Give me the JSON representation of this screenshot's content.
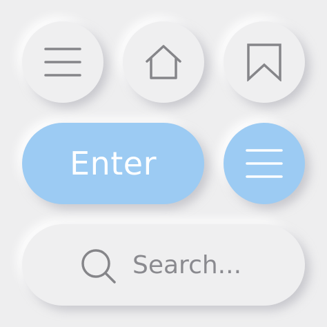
{
  "buttons": {
    "menu": {
      "icon": "hamburger-menu-icon"
    },
    "home": {
      "icon": "home-icon"
    },
    "bookmark": {
      "icon": "bookmark-icon"
    },
    "enter": {
      "label": "Enter"
    },
    "menu_accent": {
      "icon": "hamburger-menu-icon"
    }
  },
  "search": {
    "placeholder": "Search...",
    "icon": "search-icon"
  },
  "colors": {
    "background": "#eeeeef",
    "accent": "#9ccbf3",
    "icon_gray": "#858589",
    "icon_light": "#ffffff"
  }
}
